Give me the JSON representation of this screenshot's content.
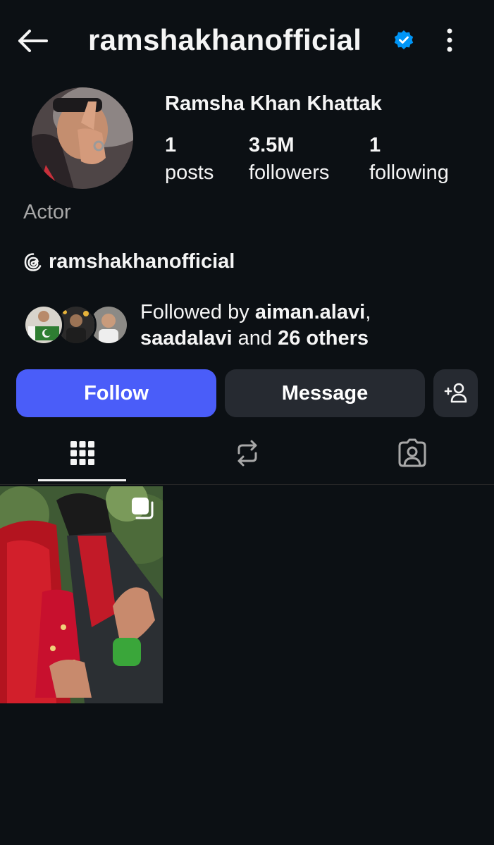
{
  "header": {
    "username": "ramshakhanofficial",
    "back_icon": "arrow-left-icon",
    "verified_icon": "verified-badge-icon",
    "more_icon": "more-vertical-icon"
  },
  "profile": {
    "full_name": "Ramsha Khan Khattak",
    "category": "Actor",
    "stats": [
      {
        "value": "1",
        "label": "posts"
      },
      {
        "value": "3.5M",
        "label": "followers"
      },
      {
        "value": "1",
        "label": "following"
      }
    ],
    "threads_handle": "ramshakhanofficial",
    "threads_icon": "threads-icon"
  },
  "followed_by": {
    "prefix": "Followed by ",
    "user1": "aiman.alavi",
    "comma": ",",
    "user2": "saadalavi",
    "and": " and ",
    "others": "26 others"
  },
  "actions": {
    "follow": "Follow",
    "message": "Message",
    "add_user_icon": "add-user-icon"
  },
  "tabs": [
    {
      "name": "posts-grid",
      "icon": "grid-icon",
      "active": true
    },
    {
      "name": "reposts",
      "icon": "repost-icon",
      "active": false
    },
    {
      "name": "tagged",
      "icon": "tagged-user-icon",
      "active": false
    }
  ],
  "colors": {
    "background": "#0c1014",
    "follow_button": "#4a5df9",
    "secondary_button": "#262a31",
    "verified": "#0095f6",
    "muted_text": "#a8a8a8"
  }
}
